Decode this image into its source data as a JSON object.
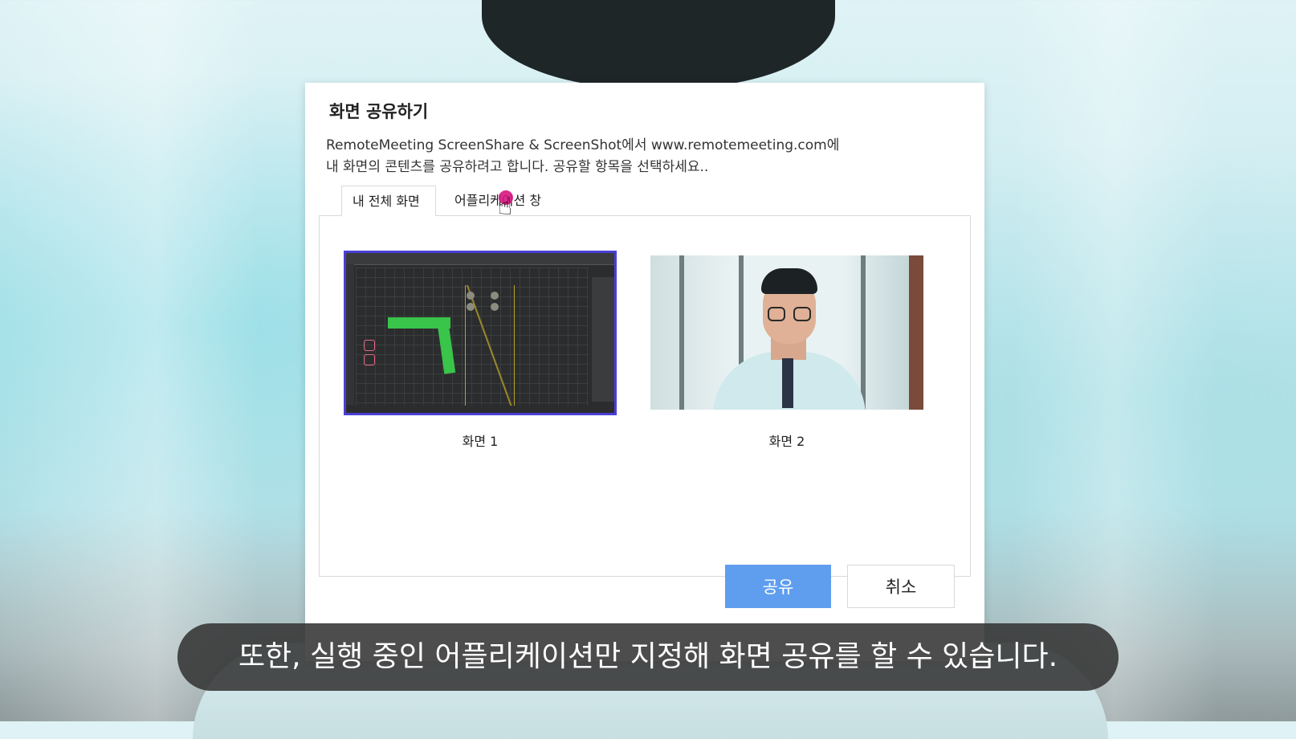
{
  "dialog": {
    "title": "화면 공유하기",
    "description_line1": "RemoteMeeting ScreenShare & ScreenShot에서 www.remotemeeting.com에",
    "description_line2": "내 화면의 콘텐츠를 공유하려고 합니다. 공유할 항목을 선택하세요..",
    "tabs": [
      {
        "label": "내 전체 화면",
        "active": true
      },
      {
        "label": "어플리케이션 창",
        "active": false
      }
    ],
    "screens": [
      {
        "label": "화면 1",
        "selected": true
      },
      {
        "label": "화면 2",
        "selected": false
      }
    ],
    "share_button": "공유",
    "cancel_button": "취소"
  },
  "subtitle": "또한, 실행 중인 어플리케이션만 지정해 화면 공유를 할 수 있습니다.",
  "colors": {
    "accent": "#5f9eef",
    "selection_border": "#4a3fd6",
    "cursor_highlight": "#d6167f"
  }
}
